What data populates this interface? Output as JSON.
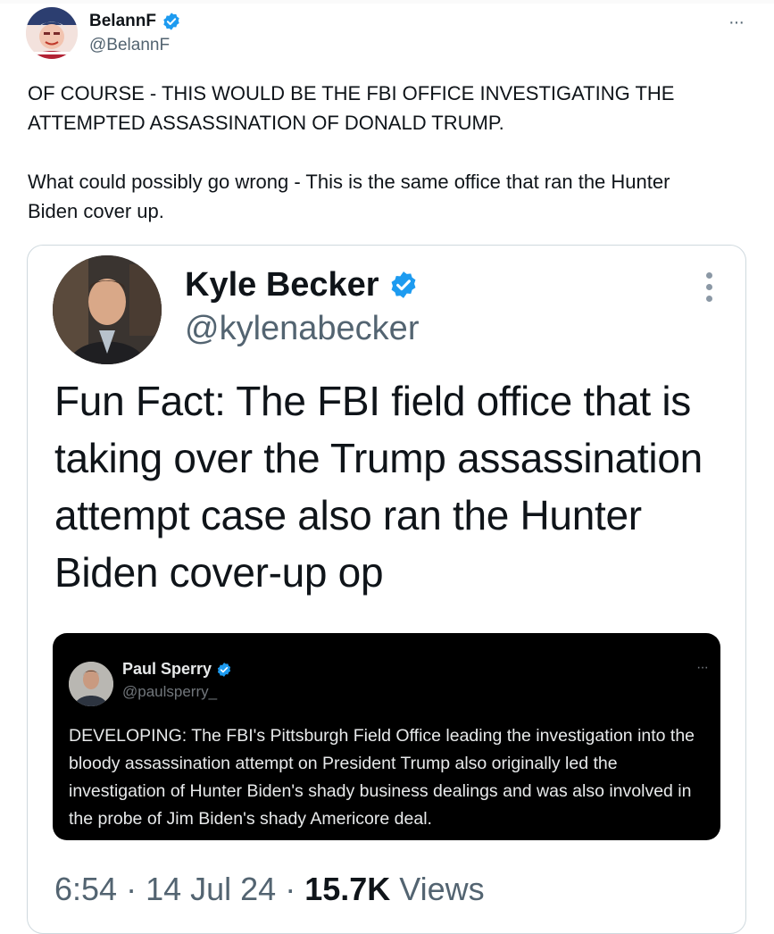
{
  "tweet": {
    "author_name": "BelannF",
    "author_handle": "@BelannF",
    "more_label": "···",
    "text": "OF COURSE - THIS WOULD BE THE FBI OFFICE INVESTIGATING THE\nATTEMPTED ASSASSINATION OF DONALD TRUMP.\n\nWhat could possibly go wrong - This is the same office that ran the Hunter\nBiden cover up."
  },
  "embedded": {
    "author_name": "Kyle Becker",
    "author_handle": "@kylenabecker",
    "text": "Fun Fact: The FBI field office that is taking over the Trump assassination attempt case also ran the Hunter Biden cover-up op",
    "quote": {
      "author_name": "Paul Sperry",
      "author_handle": "@paulsperry_",
      "more_label": "···",
      "text": "DEVELOPING: The FBI's Pittsburgh Field Office leading the investigation into the bloody assassination attempt on President Trump also originally led the investigation of Hunter Biden's shady business dealings and was also involved in the probe of Jim Biden's shady Americore deal."
    },
    "time": "6:54",
    "separator": " · ",
    "date": "14 Jul 24",
    "view_count": "15.7K",
    "views_label": "Views"
  },
  "colors": {
    "verified": "#1d9bf0",
    "secondary_text": "#536471",
    "quote_bg": "#000000"
  }
}
